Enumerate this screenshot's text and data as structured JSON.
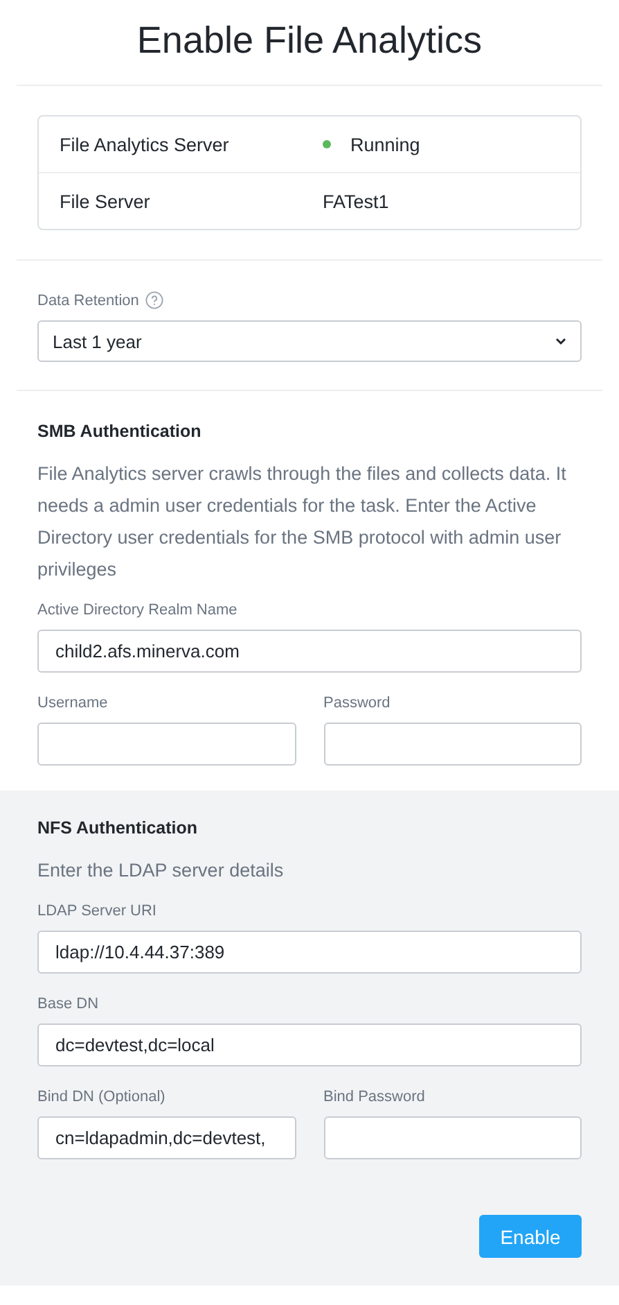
{
  "title": "Enable File Analytics",
  "info_rows": [
    {
      "label": "File Analytics Server",
      "kind": "status",
      "value": "Running",
      "color": "#5cb85c"
    },
    {
      "label": "File Server",
      "kind": "text",
      "value": "FATest1"
    }
  ],
  "data_retention": {
    "label": "Data Retention",
    "value": "Last 1 year"
  },
  "smb": {
    "heading": "SMB Authentication",
    "description": "File Analytics server crawls through the files and collects data. It needs a admin user credentials for the task. Enter the Active Directory user credentials for the SMB protocol with admin user privileges",
    "fields": [
      [
        {
          "label": "Active Directory Realm Name",
          "value": "child2.afs.minerva.com"
        }
      ],
      [
        {
          "label": "Username"
        },
        {
          "label": "Password"
        }
      ]
    ]
  },
  "nfs": {
    "heading": "NFS Authentication",
    "description": "Enter the LDAP server details",
    "fields": [
      [
        {
          "label": "LDAP Server URI",
          "value": "ldap://10.4.44.37:389"
        }
      ],
      [
        {
          "label": "Base DN",
          "value": "dc=devtest,dc=local"
        }
      ],
      [
        {
          "label": "Bind DN (Optional)",
          "value": "cn=ldapadmin,dc=devtest,"
        },
        {
          "label": "Bind Password"
        }
      ]
    ]
  },
  "enable_button": "Enable"
}
